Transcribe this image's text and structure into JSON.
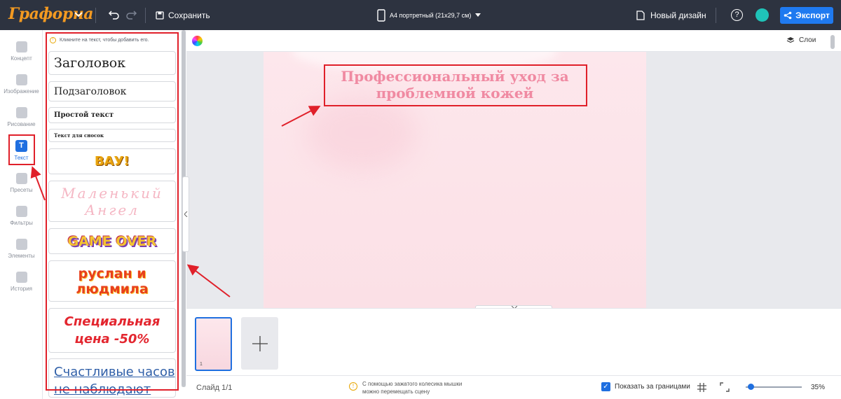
{
  "header": {
    "logo": "Графорна",
    "save_label": "Сохранить",
    "format_label": "A4 портретный (21x29,7 см)",
    "new_design_label": "Новый дизайн",
    "help_label": "?",
    "export_label": "Экспорт"
  },
  "sidebar": {
    "items": [
      {
        "label": "Концепт",
        "icon": "layout-icon"
      },
      {
        "label": "Изображение",
        "icon": "image-icon"
      },
      {
        "label": "Рисование",
        "icon": "draw-icon"
      },
      {
        "label": "Текст",
        "icon": "text-icon",
        "glyph": "T",
        "active": true
      },
      {
        "label": "Пресеты",
        "icon": "presets-icon"
      },
      {
        "label": "Фильтры",
        "icon": "filters-icon"
      },
      {
        "label": "Элементы",
        "icon": "elements-icon"
      },
      {
        "label": "История",
        "icon": "history-icon"
      }
    ]
  },
  "text_panel": {
    "hint": "Кликните на текст, чтобы добавить его.",
    "presets": [
      "Заголовок",
      "Подзаголовок",
      "Простой текст",
      "Текст для сносок",
      "ВАУ!",
      "Маленький Ангел",
      "GAME OVER",
      "руслан и людмила",
      "Специальная цена -50%",
      "Счастливые часов не наблюдают"
    ]
  },
  "canvas": {
    "headline": "Профессиональный уход за проблемной кожей",
    "layers_label": "Слои"
  },
  "slides": {
    "thumb_number": "1"
  },
  "status": {
    "slide_count": "Слайд 1/1",
    "tip_line1": "С помощью зажатого колесика мышки",
    "tip_line2": "можно перемещать сцену",
    "show_bounds_label": "Показать за границами",
    "show_bounds_checked": true,
    "zoom": "35%"
  },
  "colors": {
    "topbar": "#2d3340",
    "accent": "#1f6fe0",
    "export": "#1f7af0",
    "logo": "#f39a21",
    "annotation": "#e0202a",
    "headline": "#f08aa2"
  }
}
